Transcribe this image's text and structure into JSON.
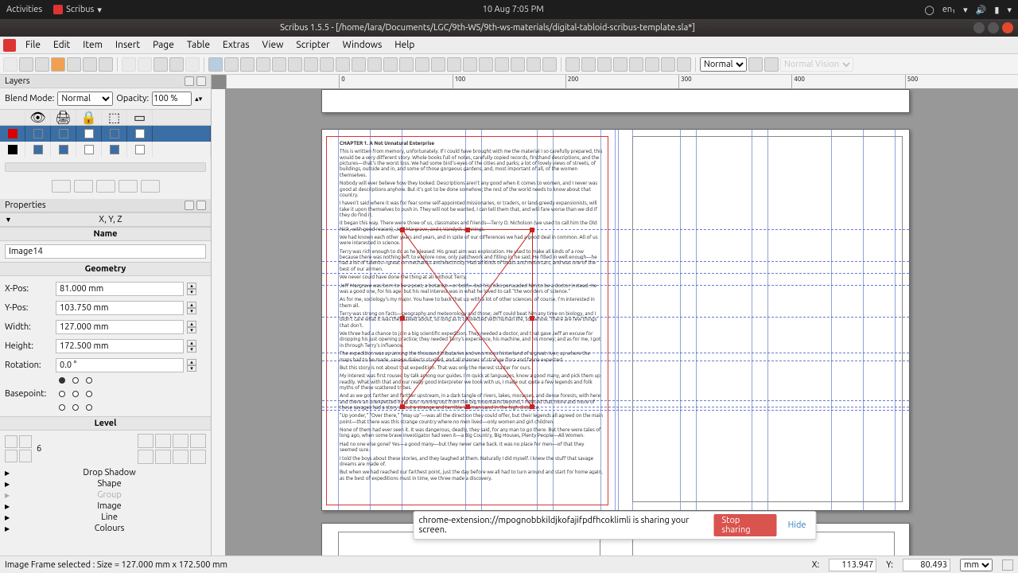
{
  "gnome": {
    "activities": "Activities",
    "app": "Scribus",
    "clock": "10 Aug  7:05 PM",
    "lang": "en₁"
  },
  "titlebar": {
    "title": "Scribus 1.5.5 - [/home/lara/Documents/LGC/9th-WS/9th-ws-materials/digital-tabloid-scribus-template.sla*]"
  },
  "menu": {
    "items": [
      "File",
      "Edit",
      "Item",
      "Insert",
      "Page",
      "Table",
      "Extras",
      "View",
      "Scripter",
      "Windows",
      "Help"
    ]
  },
  "toolbar": {
    "preview_select": "Normal",
    "vision_select": "Normal Vision"
  },
  "layers_panel": {
    "title": "Layers",
    "blendmode_label": "Blend Mode:",
    "blendmode_value": "Normal",
    "opacity_label": "Opacity:",
    "opacity_value": "100 %",
    "rows": [
      {
        "color": "#d80000",
        "vis": true,
        "print": true,
        "lock": false,
        "flow": true,
        "outline": false,
        "sel": true
      },
      {
        "color": "#000000",
        "vis": true,
        "print": true,
        "lock": false,
        "flow": true,
        "outline": false,
        "sel": false
      }
    ]
  },
  "props": {
    "title": "Properties",
    "xyz_label": "X, Y, Z",
    "name_label": "Name",
    "name_value": "Image14",
    "geometry_label": "Geometry",
    "xpos_label": "X-Pos:",
    "xpos_value": "81.000 mm",
    "ypos_label": "Y-Pos:",
    "ypos_value": "103.750 mm",
    "width_label": "Width:",
    "width_value": "127.000 mm",
    "height_label": "Height:",
    "height_value": "172.500 mm",
    "rotation_label": "Rotation:",
    "rotation_value": "0.0 °",
    "basepoint_label": "Basepoint:",
    "level_label": "Level",
    "level_value": "6",
    "sections": {
      "drop_shadow": "Drop Shadow",
      "shape": "Shape",
      "group": "Group",
      "image": "Image",
      "line": "Line",
      "colours": "Colours"
    }
  },
  "ruler": {
    "ticks": [
      "0",
      "100",
      "200",
      "300",
      "400",
      "500"
    ],
    "vtick": ""
  },
  "document_text": {
    "chapter": "CHAPTER 1. A Not Unnatural Enterprise",
    "paras": [
      "This is written from memory, unfortunately. If I could have brought with me the material I so carefully prepared, this would be a very different story. Whole books full of notes, carefully copied records, firsthand descriptions, and the pictures—that's the worst loss. We had some bird's-eyes of the cities and parks; a lot of lovely views of streets, of buildings, outside and in, and some of those gorgeous gardens, and, most important of all, of the women themselves.",
      "Nobody will ever believe how they looked. Descriptions aren't any good when it comes to women, and I never was good at descriptions anyhow. But it's got to be done somehow; the rest of the world needs to know about that country.",
      "I haven't said where it was for fear some self-appointed missionaries, or traders, or land-greedy expansionists, will take it upon themselves to push in. They will not be wanted, I can tell them that, and will fare worse than we did if they do find it.",
      "It began this way. There were three of us, classmates and friends—Terry O. Nicholson (we used to call him the Old Nick, with good reason), Jeff Margrave, and I, Vandyck Jennings.",
      "We had known each other years and years, and in spite of our differences we had a good deal in common. All of us were interested in science.",
      "Terry was rich enough to do as he pleased. His great aim was exploration. He used to make all kinds of a row because there was nothing left to explore now, only patchwork and filling in, he said. He filled in well enough—he had a lot of talents—great on mechanics and electricity. Had all kinds of boats and motorcars, and was one of the best of our airmen.",
      "We never could have done the thing at all without Terry.",
      "Jeff Margrave was born to be a poet, a botanist—or both—but his folks persuaded him to be a doctor instead. He was a good one, for his age, but his real interest was in what he loved to call \"the wonders of science.\"",
      "As for me, sociology's my major. You have to back that up with a lot of other sciences, of course. I'm interested in them all.",
      "Terry was strong on facts—geography and meteorology and those; Jeff could beat him any time on biology, and I didn't care what it was they talked about, so long as it connected with human life, somehow. There are few things that don't.",
      "We three had a chance to join a big scientific expedition. They needed a doctor, and that gave Jeff an excuse for dropping his just opening practice; they needed Terry's experience, his machine, and his money; and as for me, I got in through Terry's influence.",
      "The expedition was up among the thousand tributaries and enormous hinterland of a great river, up where the maps had to be made, savage dialects studied, and all manner of strange flora and fauna expected.",
      "But this story is not about that expedition. That was only the merest starter for ours.",
      "My interest was first roused by talk among our guides. I'm quick at languages, know a good many, and pick them up readily. What with that and our really good interpreter we took with us, I made out quite a few legends and folk myths of these scattered tribes.",
      "And as we got farther and farther upstream, in a dark tangle of rivers, lakes, morasses, and dense forests, with here and there an unexpected long spur running out from the big mountains beyond, I noticed that more and more of these savages had a story about a strange and terrible Woman Land in the high distance.",
      "\"Up yonder,\" \"Over there,\" \"Way up\"—was all the direction they could offer, but their legends all agreed on the main point—that there was this strange country where no men lived—only women and girl children.",
      "None of them had ever seen it. It was dangerous, deadly, they said, for any man to go there. But there were tales of long ago, when some brave investigator had seen it—a Big Country, Big Houses, Plenty People—All Women.",
      "Had no one else gone? Yes—a good many—but they never came back. It was no place for men—of that they seemed sure.",
      "I told the boys about these stories, and they laughed at them. Naturally I did myself. I knew the stuff that savage dreams are made of.",
      "But when we had reached our farthest point, just the day before we all had to turn around and start for home again, as the best of expeditions must in time, we three made a discovery."
    ]
  },
  "share": {
    "msg": "chrome-extension://mpognobbkildjkofajifpdfhcoklimli is sharing your screen.",
    "stop": "Stop sharing",
    "hide": "Hide"
  },
  "status": {
    "selection": "Image Frame selected : Size = 127.000 mm x 172.500 mm",
    "x_label": "X:",
    "x_value": "113.947",
    "y_label": "Y:",
    "y_value": "80.493",
    "unit": "mm"
  }
}
